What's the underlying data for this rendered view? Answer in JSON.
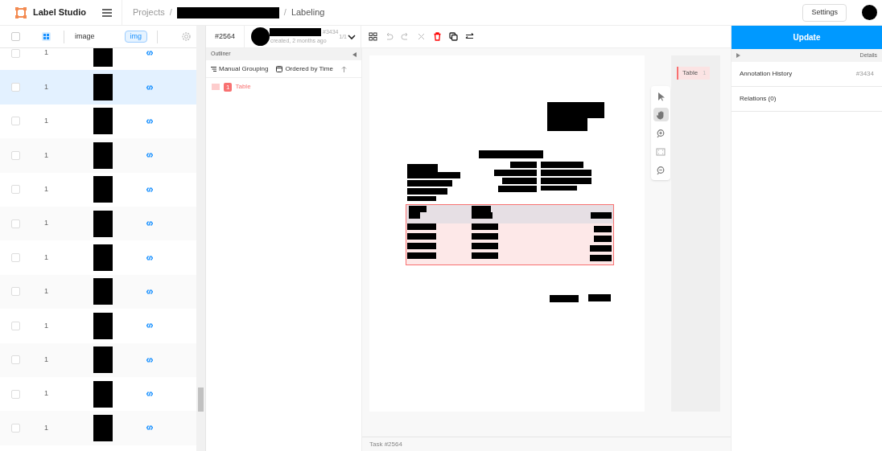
{
  "header": {
    "app": "Label Studio",
    "breadcrumb": [
      "Projects",
      "/",
      "/",
      "Labeling"
    ],
    "settings": "Settings"
  },
  "table": {
    "select_all": {
      "checked": false
    },
    "columns": [
      {
        "label": "image"
      },
      {
        "label": "img"
      }
    ],
    "rows": [
      {
        "value": "1",
        "selected": false,
        "checked": false
      },
      {
        "value": "1",
        "selected": true,
        "checked": false
      },
      {
        "value": "1",
        "selected": false,
        "checked": false
      },
      {
        "value": "1",
        "selected": false,
        "checked": false
      },
      {
        "value": "1",
        "selected": false,
        "checked": false
      },
      {
        "value": "1",
        "selected": false,
        "checked": false
      },
      {
        "value": "1",
        "selected": false,
        "checked": false
      },
      {
        "value": "1",
        "selected": false,
        "checked": false
      },
      {
        "value": "1",
        "selected": false,
        "checked": false
      },
      {
        "value": "1",
        "selected": false,
        "checked": false
      },
      {
        "value": "1",
        "selected": false,
        "checked": false
      },
      {
        "value": "1",
        "selected": false,
        "checked": false
      }
    ]
  },
  "annotation": {
    "task": "#2564",
    "id": "#3434",
    "created": "created, 2 months ago",
    "counter": "1/1"
  },
  "outliner": {
    "title": "Outliner",
    "grouping": "Manual Grouping",
    "ordering": "Ordered by Time",
    "regions": [
      {
        "index": "1",
        "label": "Table",
        "color": "#f87171"
      }
    ]
  },
  "labels": [
    {
      "label": "Table",
      "count": "1",
      "color": "#f87171"
    }
  ],
  "tools": [
    {
      "kind": "pointer",
      "selected": false
    },
    {
      "kind": "hand",
      "selected": true
    },
    {
      "kind": "zoom-in",
      "selected": false
    },
    {
      "kind": "fit",
      "selected": false
    },
    {
      "kind": "zoom-out",
      "selected": false
    }
  ],
  "sidebar": {
    "update": "Update",
    "details": "Details",
    "sections": [
      {
        "title": "Annotation History",
        "value": "#3434"
      },
      {
        "title": "Relations (0)"
      }
    ]
  },
  "footer": "Task #2564"
}
